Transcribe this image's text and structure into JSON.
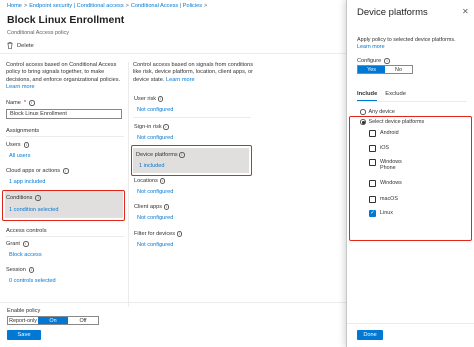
{
  "breadcrumb": [
    "Home",
    "Endpoint security | Conditional access",
    "Conditional Access | Policies"
  ],
  "title": "Block Linux Enrollment",
  "subtitle": "Conditional Access policy",
  "toolbar": {
    "delete_label": "Delete"
  },
  "left": {
    "description": "Control access based on Conditional Access policy to bring signals together, to make decisions, and enforce organizational policies.",
    "learn_more": "Learn more",
    "name_label": "Name",
    "name_value": "Block Linux Enrollment",
    "assignments": "Assignments",
    "users_label": "Users",
    "users_value": "All users",
    "cloud_label": "Cloud apps or actions",
    "cloud_value": "1 app included",
    "conditions_label": "Conditions",
    "conditions_value": "1 condition selected",
    "access_controls": "Access controls",
    "grant_label": "Grant",
    "grant_value": "Block access",
    "session_label": "Session",
    "session_value": "0 controls selected"
  },
  "middle": {
    "description": "Control access based on signals from conditions like risk, device platform, location, client apps, or device state.",
    "learn_more": "Learn more",
    "user_risk_label": "User risk",
    "user_risk_value": "Not configured",
    "signin_risk_label": "Sign-in risk",
    "signin_risk_value": "Not configured",
    "device_platforms_label": "Device platforms",
    "device_platforms_value": "1 included",
    "locations_label": "Locations",
    "locations_value": "Not configured",
    "client_apps_label": "Client apps",
    "client_apps_value": "Not configured",
    "filter_label": "Filter for devices",
    "filter_value": "Not configured"
  },
  "footer": {
    "enable_label": "Enable policy",
    "options": [
      "Report-only",
      "On",
      "Off"
    ],
    "selected": "On",
    "save_label": "Save"
  },
  "panel": {
    "title": "Device platforms",
    "close": "✕",
    "apply_text": "Apply policy to selected device platforms.",
    "learn_more": "Learn more",
    "configure_label": "Configure",
    "configure_options": [
      "Yes",
      "No"
    ],
    "configure_selected": "Yes",
    "tabs": [
      "Include",
      "Exclude"
    ],
    "active_tab": "Include",
    "any_device": "Any device",
    "select_platforms": "Select device platforms",
    "platforms": [
      {
        "label": "Android",
        "checked": false
      },
      {
        "label": "iOS",
        "checked": false
      },
      {
        "label": "Windows Phone",
        "checked": false
      },
      {
        "label": "Windows",
        "checked": false
      },
      {
        "label": "macOS",
        "checked": false
      },
      {
        "label": "Linux",
        "checked": true
      }
    ],
    "done_label": "Done"
  },
  "colors": {
    "accent": "#0078d4",
    "highlight": "#e0271a",
    "selected_bg": "#e1dfdd"
  }
}
